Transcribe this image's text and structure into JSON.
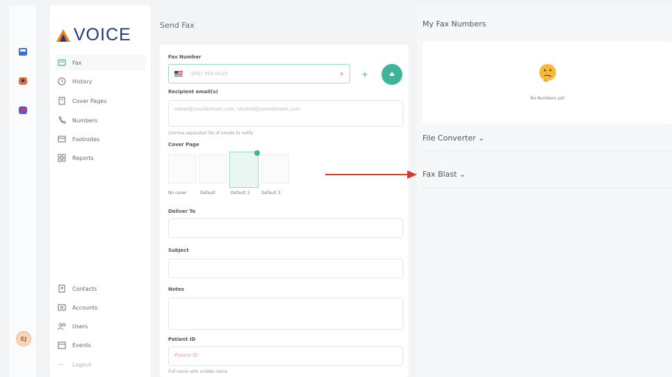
{
  "app": {
    "logo_text": "VOICE"
  },
  "rail": {
    "avatar_initials": "EJ"
  },
  "sidebar": {
    "items": [
      {
        "label": "Fax",
        "icon": "fax-icon"
      },
      {
        "label": "History",
        "icon": "history-icon"
      },
      {
        "label": "Cover Pages",
        "icon": "cover-pages-icon"
      },
      {
        "label": "Numbers",
        "icon": "phone-icon"
      },
      {
        "label": "Footnotes",
        "icon": "footnotes-icon"
      },
      {
        "label": "Reports",
        "icon": "reports-icon"
      }
    ],
    "bottom_items": [
      {
        "label": "Contacts",
        "icon": "contacts-icon"
      },
      {
        "label": "Accounts",
        "icon": "accounts-icon"
      },
      {
        "label": "Users",
        "icon": "users-icon"
      },
      {
        "label": "Events",
        "icon": "events-icon"
      },
      {
        "label": "Logout",
        "icon": "logout-icon"
      }
    ]
  },
  "send_fax": {
    "title": "Send Fax",
    "fax_number_label": "Fax Number",
    "fax_number_placeholder": "(201) 555-0123",
    "recipient_label": "Recipient email(s)",
    "recipient_placeholder": "name@yourdomain.com, second@yourdomain.com",
    "recipient_hint": "Comma separated list of emails to notify",
    "cover_page_label": "Cover Page",
    "cover_options": [
      "No cover",
      "Default",
      "Default 2",
      "Default 3"
    ],
    "deliver_to_label": "Deliver To",
    "subject_label": "Subject",
    "notes_label": "Notes",
    "patient_id_label": "Patient ID",
    "patient_id_placeholder": "Patient ID",
    "patient_hint": "Full name with middle name"
  },
  "right": {
    "my_numbers_title": "My Fax Numbers",
    "no_numbers_text": "No Numbers yet",
    "file_converter_label": "File Converter ⌄",
    "fax_blast_label": "Fax Blast ⌄"
  },
  "colors": {
    "accent": "#3fb39b",
    "logo_orange": "#f07a24",
    "arrow_red": "#d33a2c"
  }
}
